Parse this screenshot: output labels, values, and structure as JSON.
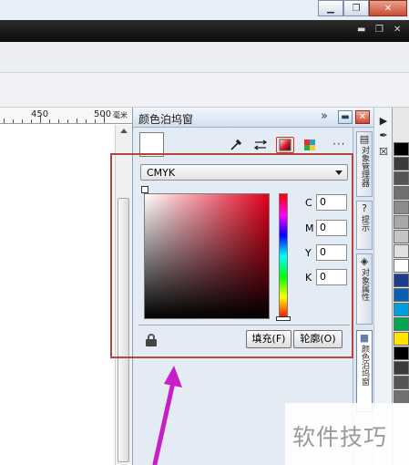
{
  "ruler": {
    "labels": [
      "450",
      "500"
    ],
    "unit": "毫米"
  },
  "docker": {
    "title": "颜色泊坞窗",
    "chevron": "»",
    "mode_select": {
      "selected": "CMYK"
    },
    "channels": [
      {
        "label": "C",
        "value": "0"
      },
      {
        "label": "M",
        "value": "0"
      },
      {
        "label": "Y",
        "value": "0"
      },
      {
        "label": "K",
        "value": "0"
      }
    ],
    "fill_button": "填充(F)",
    "outline_button": "轮廓(O)",
    "side_tabs": [
      "对象管理器",
      "提示",
      "对象属性",
      "颜色泊坞窗"
    ]
  },
  "colors": {
    "highlight": "#b5443a",
    "arrow": "#c81ec8",
    "gradient_red": "#e4001b"
  },
  "palette": [
    "#000000",
    "#3b3b3b",
    "#555555",
    "#707070",
    "#8c8c8c",
    "#a8a8a8",
    "#c4c4c4",
    "#e0e0e0",
    "#ffffff",
    "#1f3c8f",
    "#0b5fb0",
    "#00a0e0",
    "#00a651",
    "#ffe400"
  ],
  "watermark": "软件技巧"
}
